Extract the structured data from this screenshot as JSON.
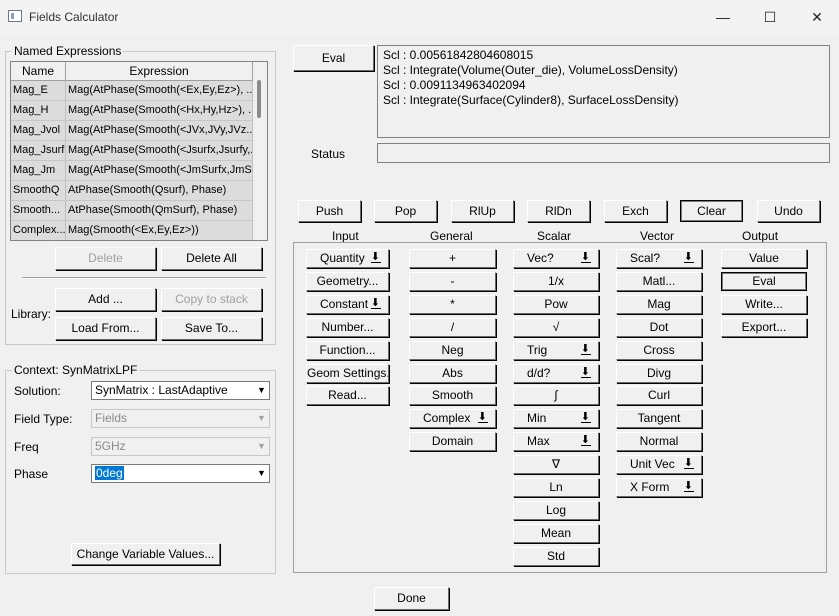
{
  "window": {
    "title": "Fields Calculator",
    "minimize": "—",
    "maximize": "☐",
    "close": "✕"
  },
  "named_expressions": {
    "label": "Named Expressions",
    "columns": [
      "Name",
      "Expression"
    ],
    "rows": [
      {
        "name": "Mag_E",
        "expr": "Mag(AtPhase(Smooth(<Ex,Ey,Ez>), ..."
      },
      {
        "name": "Mag_H",
        "expr": "Mag(AtPhase(Smooth(<Hx,Hy,Hz>), ..."
      },
      {
        "name": "Mag_Jvol",
        "expr": "Mag(AtPhase(Smooth(<JVx,JVy,JVz..."
      },
      {
        "name": "Mag_Jsurf",
        "expr": "Mag(AtPhase(Smooth(<Jsurfx,Jsurfy,..."
      },
      {
        "name": "Mag_Jm",
        "expr": "Mag(AtPhase(Smooth(<JmSurfx,JmS..."
      },
      {
        "name": "SmoothQ",
        "expr": "AtPhase(Smooth(Qsurf), Phase)"
      },
      {
        "name": "Smooth...",
        "expr": "AtPhase(Smooth(QmSurf), Phase)"
      },
      {
        "name": "Complex...",
        "expr": "Mag(Smooth(<Ex,Ey,Ez>))"
      }
    ],
    "delete": "Delete",
    "delete_all": "Delete All",
    "library_label": "Library:",
    "add": "Add ...",
    "copy_to_stack": "Copy to stack",
    "load_from": "Load From...",
    "save_to": "Save To..."
  },
  "context": {
    "label": "Context: SynMatrixLPF",
    "solution_label": "Solution:",
    "solution_value": "SynMatrix : LastAdaptive",
    "field_type_label": "Field Type:",
    "field_type_value": "Fields",
    "freq_label": "Freq",
    "freq_value": "5GHz",
    "phase_label": "Phase",
    "phase_value": "0deg",
    "change_vars": "Change Variable Values..."
  },
  "eval_button": "Eval",
  "output_lines": [
    "Scl : 0.00561842804608015",
    "Scl : Integrate(Volume(Outer_die), VolumeLossDensity)",
    "Scl : 0.0091134963402094",
    "Scl : Integrate(Surface(Cylinder8), SurfaceLossDensity)"
  ],
  "status_label": "Status",
  "stack_buttons": {
    "push": "Push",
    "pop": "Pop",
    "rlup": "RlUp",
    "rldn": "RlDn",
    "exch": "Exch",
    "clear": "Clear",
    "undo": "Undo"
  },
  "sections": {
    "input": "Input",
    "general": "General",
    "scalar": "Scalar",
    "vector": "Vector",
    "output": "Output"
  },
  "input_buttons": [
    "Quantity",
    "Geometry...",
    "Constant",
    "Number...",
    "Function...",
    "Geom Settings...",
    "Read..."
  ],
  "general_buttons": [
    "+",
    "-",
    "*",
    "/",
    "Neg",
    "Abs",
    "Smooth",
    "Complex",
    "Domain"
  ],
  "scalar_buttons": [
    "Vec?",
    "1/x",
    "Pow",
    "√",
    "Trig",
    "d/d?",
    "∫",
    "Min",
    "Max",
    "∇",
    "Ln",
    "Log",
    "Mean",
    "Std"
  ],
  "vector_buttons": [
    "Scal?",
    "Matl...",
    "Mag",
    "Dot",
    "Cross",
    "Divg",
    "Curl",
    "Tangent",
    "Normal",
    "Unit Vec",
    "X Form"
  ],
  "output_buttons": [
    "Value",
    "Eval",
    "Write...",
    "Export..."
  ],
  "done": "Done",
  "icons": {
    "title": "window-app-icon",
    "dropdown": "down-arrow-icon"
  }
}
